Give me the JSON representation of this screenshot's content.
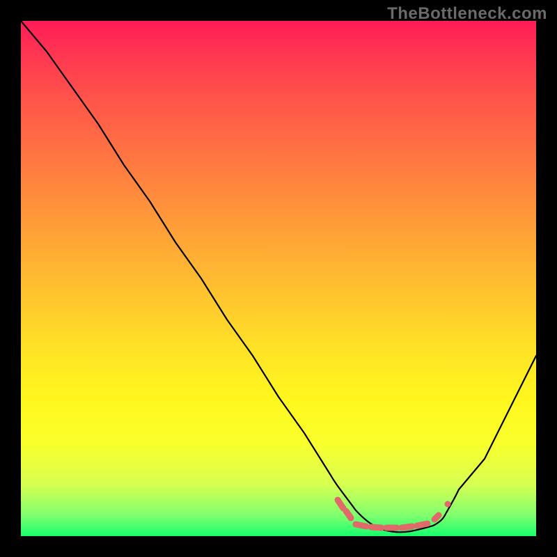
{
  "watermark": "TheBottleneck.com",
  "colors": {
    "page_bg": "#000000",
    "watermark": "#6a6a6a",
    "curve": "#000000",
    "flat_marker": "#e06a6a",
    "gradient_top": "#ff1c57",
    "gradient_bottom": "#16ff6e"
  },
  "chart_data": {
    "type": "line",
    "title": "",
    "xlabel": "",
    "ylabel": "",
    "xlim": [
      0,
      100
    ],
    "ylim": [
      0,
      100
    ],
    "grid": false,
    "legend": false,
    "series": [
      {
        "name": "bottleneck-curve",
        "x": [
          0,
          5,
          10,
          15,
          20,
          25,
          30,
          35,
          40,
          45,
          50,
          55,
          60,
          62,
          65,
          70,
          75,
          80,
          82,
          85,
          90,
          95,
          100
        ],
        "y": [
          100,
          94,
          87,
          80,
          72,
          65,
          57,
          50,
          42,
          35,
          27,
          20,
          12,
          9,
          5,
          2,
          1,
          1,
          2,
          6,
          15,
          25,
          35
        ]
      },
      {
        "name": "optimal-flat-region",
        "x": [
          62,
          82
        ],
        "y": [
          1,
          1
        ],
        "style": "dashed-markers"
      }
    ],
    "notes": "V-shaped bottleneck curve over a vertical red→green gradient background; near-zero flat region around x≈62–82 is highlighted with salmon dashed markers along the bottom."
  }
}
